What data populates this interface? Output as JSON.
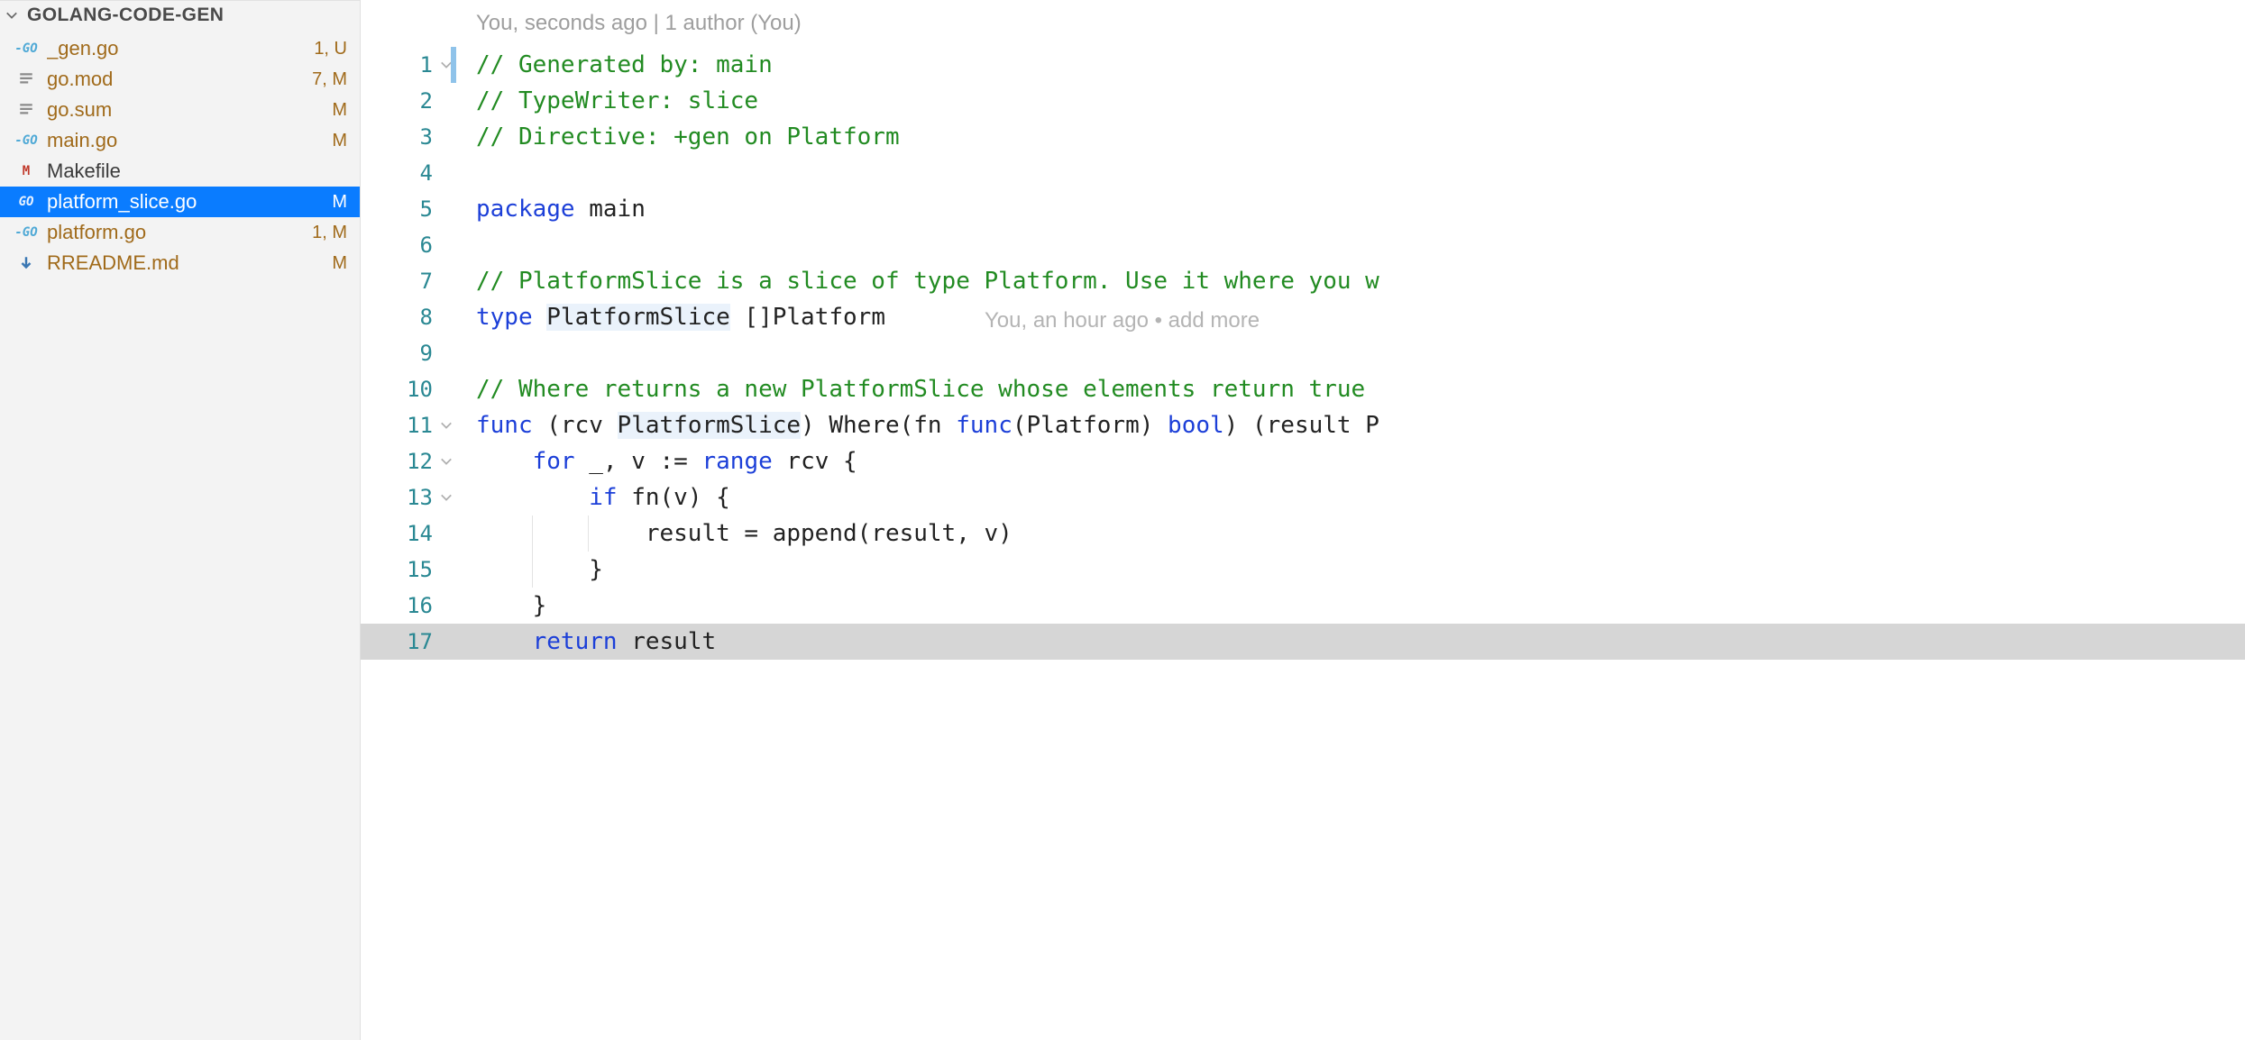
{
  "sidebar": {
    "project_name": "GOLANG-CODE-GEN",
    "files": [
      {
        "icon": "go",
        "name": "_gen.go",
        "meta": "1, U",
        "git": "gitmod",
        "selected": false
      },
      {
        "icon": "lines",
        "name": "go.mod",
        "meta": "7, M",
        "git": "gitmod",
        "selected": false
      },
      {
        "icon": "lines",
        "name": "go.sum",
        "meta": "M",
        "git": "gitmod",
        "selected": false
      },
      {
        "icon": "go",
        "name": "main.go",
        "meta": "M",
        "git": "gitmod",
        "selected": false
      },
      {
        "icon": "make",
        "name": "Makefile",
        "meta": "",
        "git": "",
        "selected": false
      },
      {
        "icon": "godim",
        "name": "platform_slice.go",
        "meta": "M",
        "git": "gitmod",
        "selected": true
      },
      {
        "icon": "go",
        "name": "platform.go",
        "meta": "1, M",
        "git": "gitmod",
        "selected": false
      },
      {
        "icon": "md",
        "name": "RREADME.md",
        "meta": "M",
        "git": "gitmod",
        "selected": false
      }
    ]
  },
  "editor": {
    "codelens": "You, seconds ago | 1 author (You)",
    "inline_blame": {
      "line": 8,
      "text": "You, an hour ago • add more "
    },
    "lines": [
      {
        "n": 1,
        "fold": "down",
        "cursor": true,
        "tokens": [
          {
            "t": "// Generated by: main",
            "c": "comment"
          }
        ]
      },
      {
        "n": 2,
        "tokens": [
          {
            "t": "// TypeWriter: slice",
            "c": "comment"
          }
        ]
      },
      {
        "n": 3,
        "tokens": [
          {
            "t": "// Directive: +gen on Platform",
            "c": "comment"
          }
        ]
      },
      {
        "n": 4,
        "tokens": []
      },
      {
        "n": 5,
        "tokens": [
          {
            "t": "package",
            "c": "keyword"
          },
          {
            "t": " main",
            "c": "black"
          }
        ]
      },
      {
        "n": 6,
        "tokens": []
      },
      {
        "n": 7,
        "tokens": [
          {
            "t": "// PlatformSlice is a slice of type Platform. Use it where you w",
            "c": "comment"
          }
        ]
      },
      {
        "n": 8,
        "highlight": true,
        "tokens": [
          {
            "t": "type",
            "c": "keyword"
          },
          {
            "t": " ",
            "c": "black"
          },
          {
            "t": "PlatformSlice",
            "c": "black",
            "sel": true
          },
          {
            "t": " []Platform",
            "c": "black"
          }
        ]
      },
      {
        "n": 9,
        "tokens": []
      },
      {
        "n": 10,
        "tokens": [
          {
            "t": "// Where returns a new PlatformSlice whose elements return true ",
            "c": "comment"
          }
        ]
      },
      {
        "n": 11,
        "fold": "down",
        "tokens": [
          {
            "t": "func",
            "c": "keyword"
          },
          {
            "t": " (rcv ",
            "c": "black"
          },
          {
            "t": "PlatformSlice",
            "c": "black",
            "sel": true
          },
          {
            "t": ") Where(fn ",
            "c": "black"
          },
          {
            "t": "func",
            "c": "keyword"
          },
          {
            "t": "(Platform) ",
            "c": "black"
          },
          {
            "t": "bool",
            "c": "keyword"
          },
          {
            "t": ") (result P",
            "c": "black"
          }
        ]
      },
      {
        "n": 12,
        "fold": "down",
        "tokens": [
          {
            "t": "    ",
            "c": "black"
          },
          {
            "t": "for",
            "c": "keyword"
          },
          {
            "t": " _, v := ",
            "c": "black"
          },
          {
            "t": "range",
            "c": "keyword"
          },
          {
            "t": " rcv {",
            "c": "black"
          }
        ]
      },
      {
        "n": 13,
        "fold": "down",
        "tokens": [
          {
            "t": "        ",
            "c": "black"
          },
          {
            "t": "if",
            "c": "keyword"
          },
          {
            "t": " fn(v) {",
            "c": "black"
          }
        ]
      },
      {
        "n": 14,
        "guides": [
          1,
          2
        ],
        "tokens": [
          {
            "t": "            result = append(result, v)",
            "c": "black"
          }
        ]
      },
      {
        "n": 15,
        "guides": [
          1
        ],
        "tokens": [
          {
            "t": "        }",
            "c": "black"
          }
        ]
      },
      {
        "n": 16,
        "tokens": [
          {
            "t": "    }",
            "c": "black"
          }
        ]
      },
      {
        "n": 17,
        "return_hl": true,
        "tokens": [
          {
            "t": "    ",
            "c": "black"
          },
          {
            "t": "return",
            "c": "keyword"
          },
          {
            "t": " result",
            "c": "black"
          }
        ]
      }
    ]
  }
}
